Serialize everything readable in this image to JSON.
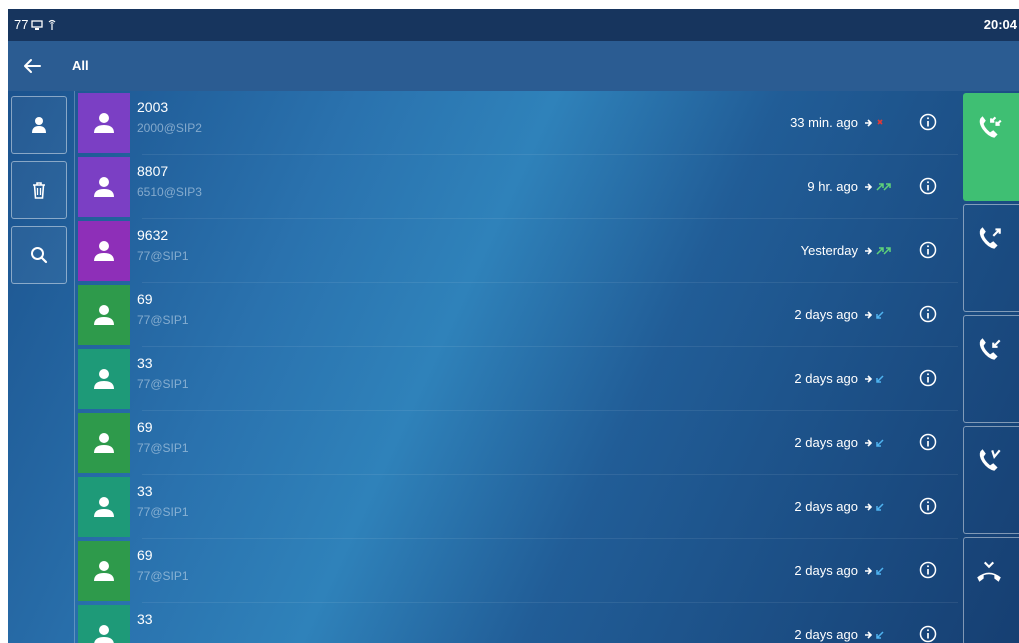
{
  "status_bar": {
    "extension": "77",
    "time": "20:04"
  },
  "title_bar": {
    "title": "All"
  },
  "left_actions": [
    {
      "icon": "contact-icon"
    },
    {
      "icon": "trash-icon"
    },
    {
      "icon": "search-icon"
    }
  ],
  "call_log": [
    {
      "name": "2003",
      "account": "2000@SIP2",
      "time": "33 min. ago",
      "avatar_color": "#7b3fc4",
      "call_type": "missed"
    },
    {
      "name": "8807",
      "account": "6510@SIP3",
      "time": "9 hr. ago",
      "avatar_color": "#7b3fc4",
      "call_type": "outgoing"
    },
    {
      "name": "9632",
      "account": "77@SIP1",
      "time": "Yesterday",
      "avatar_color": "#8e2fb8",
      "call_type": "outgoing"
    },
    {
      "name": "69",
      "account": "77@SIP1",
      "time": "2 days ago",
      "avatar_color": "#2e9a4b",
      "call_type": "received"
    },
    {
      "name": "33",
      "account": "77@SIP1",
      "time": "2 days ago",
      "avatar_color": "#1e9a78",
      "call_type": "received"
    },
    {
      "name": "69",
      "account": "77@SIP1",
      "time": "2 days ago",
      "avatar_color": "#2e9a4b",
      "call_type": "received"
    },
    {
      "name": "33",
      "account": "77@SIP1",
      "time": "2 days ago",
      "avatar_color": "#1e9a78",
      "call_type": "received"
    },
    {
      "name": "69",
      "account": "77@SIP1",
      "time": "2 days ago",
      "avatar_color": "#2e9a4b",
      "call_type": "received"
    },
    {
      "name": "33",
      "account": "",
      "time": "2 days ago",
      "avatar_color": "#1e9a78",
      "call_type": "received"
    }
  ],
  "right_actions": [
    {
      "icon": "all-calls-icon",
      "active": true
    },
    {
      "icon": "placed-calls-icon",
      "active": false
    },
    {
      "icon": "received-calls-icon",
      "active": false
    },
    {
      "icon": "missed-calls-icon",
      "active": false
    },
    {
      "icon": "forwarded-calls-icon",
      "active": false
    }
  ],
  "colors": {
    "active_tab": "#3fbf73",
    "status_bar": "#17355e",
    "title_bar": "#2b5c92"
  }
}
